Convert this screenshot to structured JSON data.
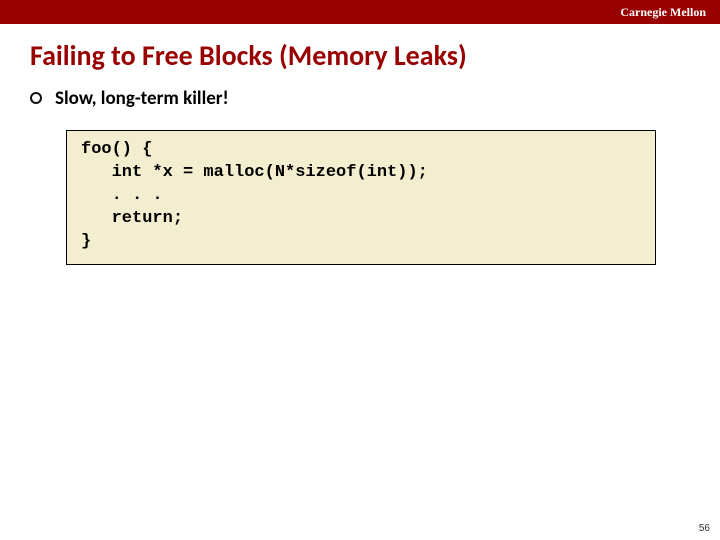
{
  "header": {
    "institution": "Carnegie Mellon"
  },
  "title": "Failing to Free Blocks (Memory Leaks)",
  "bullets": [
    {
      "text": "Slow, long-term killer!"
    }
  ],
  "code": "foo() {\n   int *x = malloc(N*sizeof(int));\n   . . .\n   return;\n}",
  "page_number": "56"
}
